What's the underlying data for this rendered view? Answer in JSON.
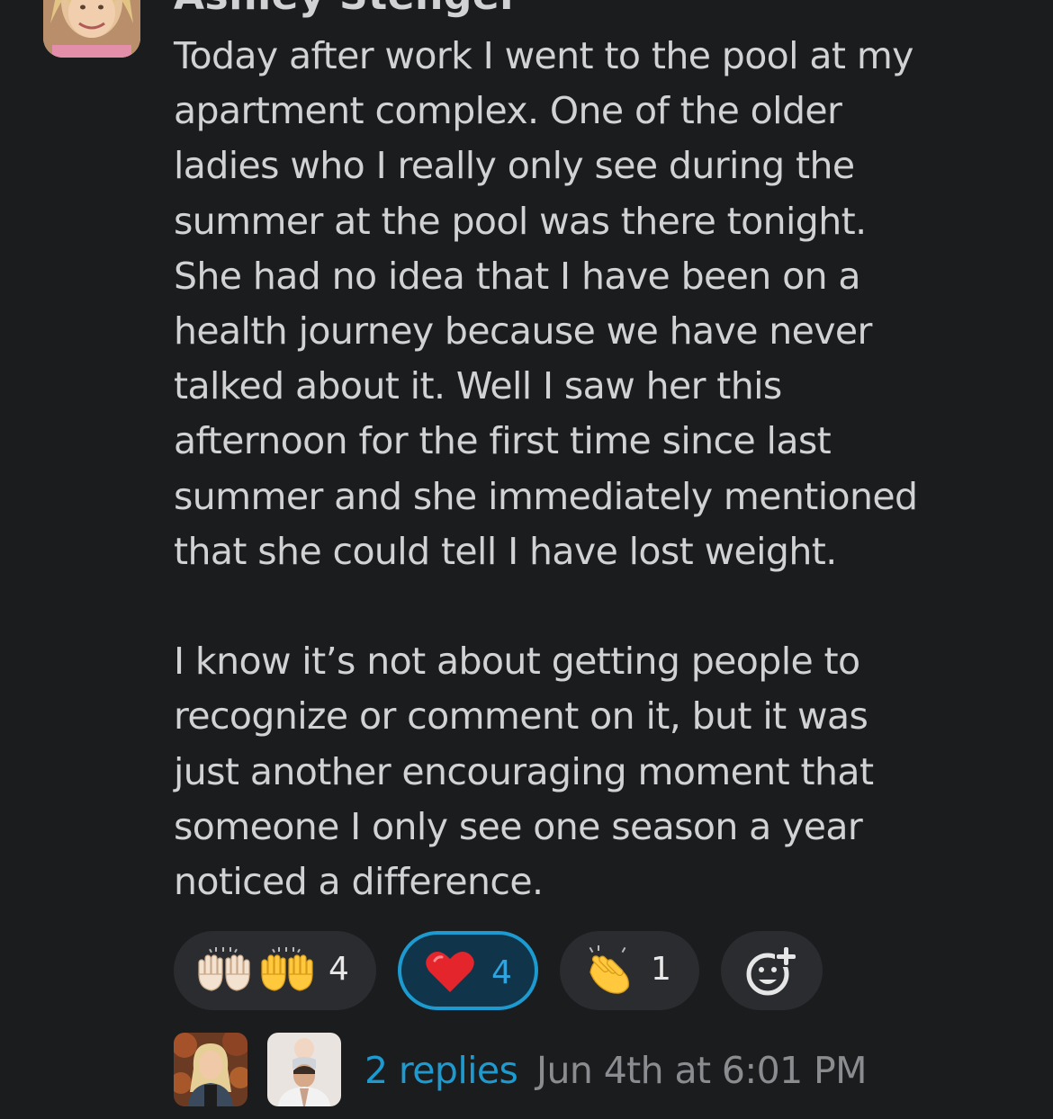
{
  "message": {
    "sender_name": "Ashley Stenger",
    "paragraphs": [
      [
        "Today after work I went to the pool at my",
        "apartment complex. One of the older",
        "ladies who I really only see during the",
        "summer at the pool was there tonight.",
        "She had no idea that I have been on a",
        "health journey because we have never",
        "talked about it. Well I saw her this",
        "afternoon for the first time since last",
        "summer and she immediately mentioned",
        "that she could tell I have lost weight."
      ],
      [
        "I know it’s not about getting people to",
        "recognize or comment on it, but it was",
        "just another encouraging moment that",
        "someone I only see one season a year",
        "noticed a difference."
      ]
    ]
  },
  "reactions": [
    {
      "icon": "raised-hands-icon",
      "count": "4",
      "active": false
    },
    {
      "icon": "heart-icon",
      "count": "4",
      "active": true
    },
    {
      "icon": "clapping-hands-icon",
      "count": "1",
      "active": false
    }
  ],
  "add_reaction": {
    "icon": "add-reaction-icon"
  },
  "thread": {
    "replies_label": "2 replies",
    "timestamp": "Jun 4th at 6:01 PM",
    "reply_avatars": [
      "avatar-woman-blonde",
      "avatar-man-with-baby"
    ]
  },
  "colors": {
    "background": "#1b1c1e",
    "text": "#d1d2d3",
    "link": "#1d9bd1",
    "muted": "#8b8c8f",
    "pill": "#2b2c2f",
    "pill_active_border": "#1d9bd1",
    "pill_active_bg": "#10354a"
  }
}
